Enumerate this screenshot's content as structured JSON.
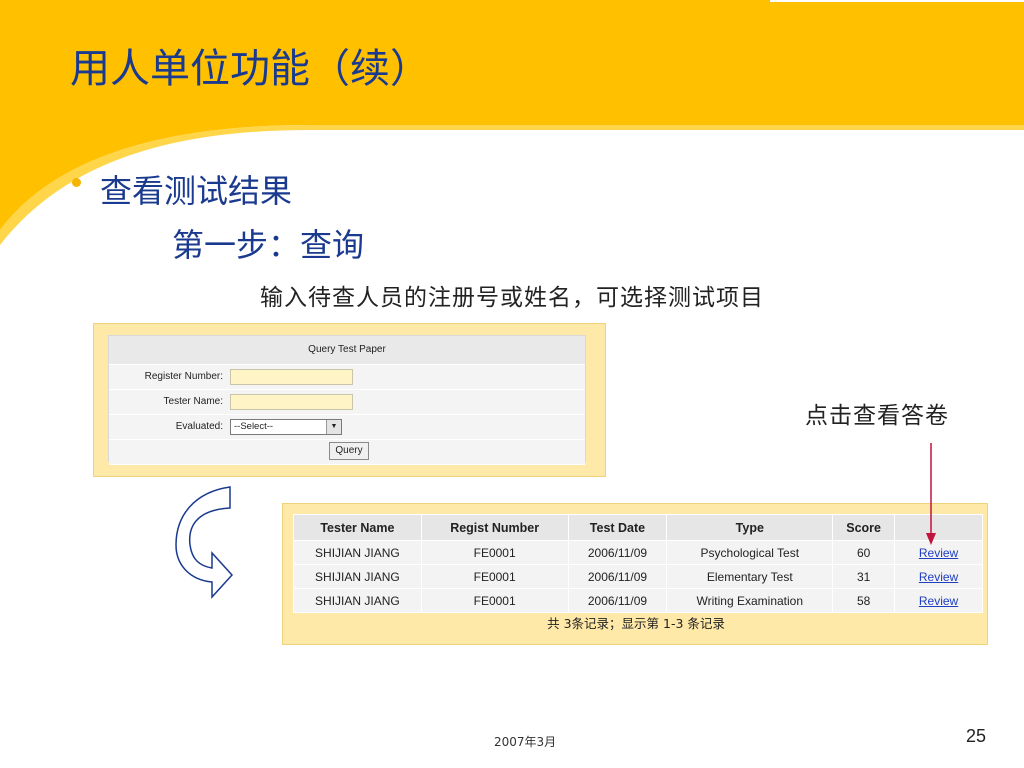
{
  "slide": {
    "title": "用人单位功能（续）",
    "bullet": "查看测试结果",
    "step": "第一步：查询",
    "instruction": "输入待查人员的注册号或姓名，可选择测试项目",
    "callout": "点击查看答卷",
    "footer_date": "2007年3月",
    "page_number": "25"
  },
  "query_form": {
    "title": "Query Test Paper",
    "register_label": "Register Number:",
    "register_value": "",
    "tester_label": "Tester Name:",
    "tester_value": "",
    "evaluated_label": "Evaluated:",
    "evaluated_selected": "--Select--",
    "query_button": "Query"
  },
  "results": {
    "columns": [
      "Tester Name",
      "Regist Number",
      "Test Date",
      "Type",
      "Score",
      ""
    ],
    "rows": [
      [
        "SHIJIAN JIANG",
        "FE0001",
        "2006/11/09",
        "Psychological Test",
        "60",
        "Review"
      ],
      [
        "SHIJIAN JIANG",
        "FE0001",
        "2006/11/09",
        "Elementary Test",
        "31",
        "Review"
      ],
      [
        "SHIJIAN JIANG",
        "FE0001",
        "2006/11/09",
        "Writing Examination",
        "58",
        "Review"
      ]
    ],
    "summary": "共 3条记录；显示第 1-3 条记录"
  },
  "colors": {
    "accent_yellow": "#ffc000",
    "title_blue": "#1a3a8f",
    "panel_bg": "#ffe9a8",
    "link_blue": "#1f3fbf",
    "arrow_red": "#c0143c"
  },
  "icons": {
    "bullet": "bullet-dot-icon",
    "curved_arrow": "curved-arrow-icon",
    "pointer_arrow": "arrow-down-icon",
    "select_arrow": "chevron-down-icon"
  }
}
